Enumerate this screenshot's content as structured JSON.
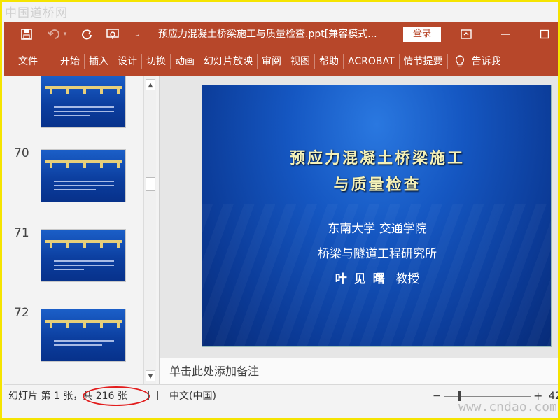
{
  "watermark": {
    "top": "中国道桥网",
    "bottom": "www.cndao.com"
  },
  "titlebar": {
    "doc_title": "预应力混凝土桥梁施工与质量检查.ppt[兼容模式...",
    "login_label": "登录"
  },
  "menu": {
    "items": [
      "文件",
      "开始",
      "插入",
      "设计",
      "切换",
      "动画",
      "幻灯片放映",
      "审阅",
      "视图",
      "帮助",
      "ACROBAT",
      "情节提要"
    ],
    "tell_me": "告诉我"
  },
  "thumbnails": {
    "numbers": [
      "70",
      "71",
      "72"
    ]
  },
  "slide": {
    "title_line1": "预应力混凝土桥梁施工",
    "title_line2": "与质量检查",
    "line1": "东南大学  交通学院",
    "line2": "桥梁与隧道工程研究所",
    "author": "叶见曙",
    "author_title": "教授"
  },
  "notes": {
    "placeholder": "单击此处添加备注"
  },
  "status": {
    "slide_info": "幻灯片 第 1 张，共 216 张",
    "language": "中文(中国)",
    "zoom": "42"
  },
  "colors": {
    "ribbon": "#b7472a",
    "annotation_circle": "#e21c1c",
    "slide_title": "#f4f1b8",
    "frame": "#f5e400"
  }
}
